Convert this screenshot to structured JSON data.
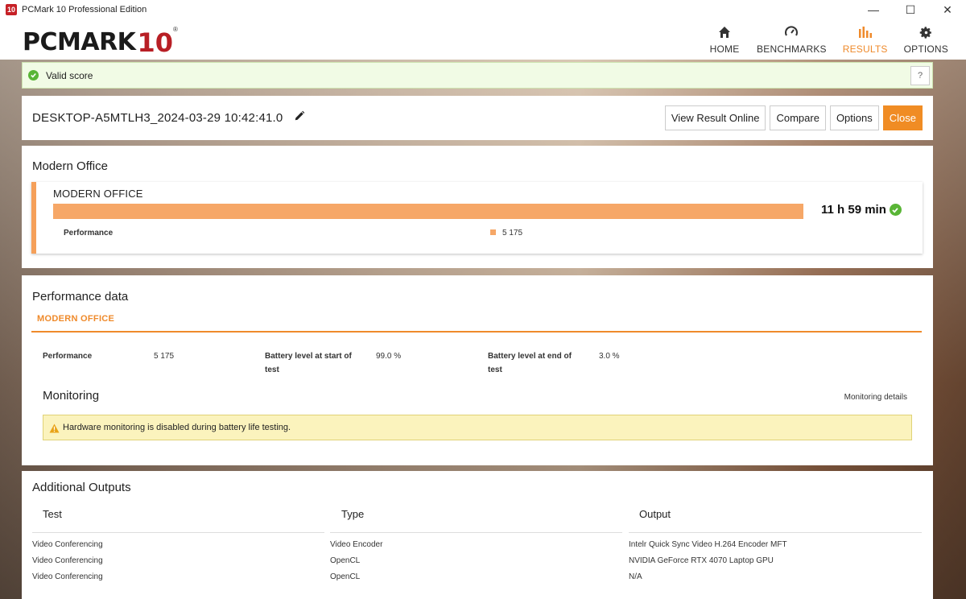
{
  "window": {
    "icon_text": "10",
    "title": "PCMark 10 Professional Edition",
    "minimize": "—",
    "maximize": "☐",
    "close": "✕"
  },
  "logo": {
    "main": "PCMARK",
    "num": "10",
    "reg": "®"
  },
  "nav": [
    {
      "label": "HOME",
      "icon": "home-icon",
      "active": false
    },
    {
      "label": "BENCHMARKS",
      "icon": "gauge-icon",
      "active": false
    },
    {
      "label": "RESULTS",
      "icon": "bar-chart-icon",
      "active": true
    },
    {
      "label": "OPTIONS",
      "icon": "gear-icon",
      "active": false
    }
  ],
  "status": {
    "text": "Valid score",
    "help": "?"
  },
  "result": {
    "name": "DESKTOP-A5MTLH3_2024-03-29 10:42:41.0",
    "buttons": {
      "view_online": "View Result Online",
      "compare": "Compare",
      "options": "Options",
      "close": "Close"
    }
  },
  "modern_office": {
    "section_title": "Modern Office",
    "card_title": "MODERN OFFICE",
    "bar_fraction": 1.0,
    "perf_label": "Performance",
    "perf_value": "5 175",
    "score": "11 h 59 min"
  },
  "performance_data": {
    "title": "Performance data",
    "tab": "MODERN OFFICE",
    "fields": [
      {
        "label": "Performance",
        "value": "5 175"
      },
      {
        "label": "Battery level at start of test",
        "value": "99.0 %"
      },
      {
        "label": "Battery level at end of test",
        "value": "3.0 %"
      }
    ],
    "monitoring_title": "Monitoring",
    "monitoring_link": "Monitoring details",
    "warning": "Hardware monitoring is disabled during battery life testing."
  },
  "additional_outputs": {
    "title": "Additional Outputs",
    "headers": [
      "Test",
      "Type",
      "Output"
    ],
    "rows": [
      [
        "Video Conferencing",
        "Video Encoder",
        "Intelr Quick Sync Video H.264 Encoder MFT"
      ],
      [
        "Video Conferencing",
        "OpenCL",
        "NVIDIA GeForce RTX 4070 Laptop GPU"
      ],
      [
        "Video Conferencing",
        "OpenCL",
        "N/A"
      ]
    ]
  },
  "colors": {
    "accent": "#ef8a2b",
    "bar": "#f6a767",
    "valid": "#59b536",
    "brand": "#b81f25"
  }
}
